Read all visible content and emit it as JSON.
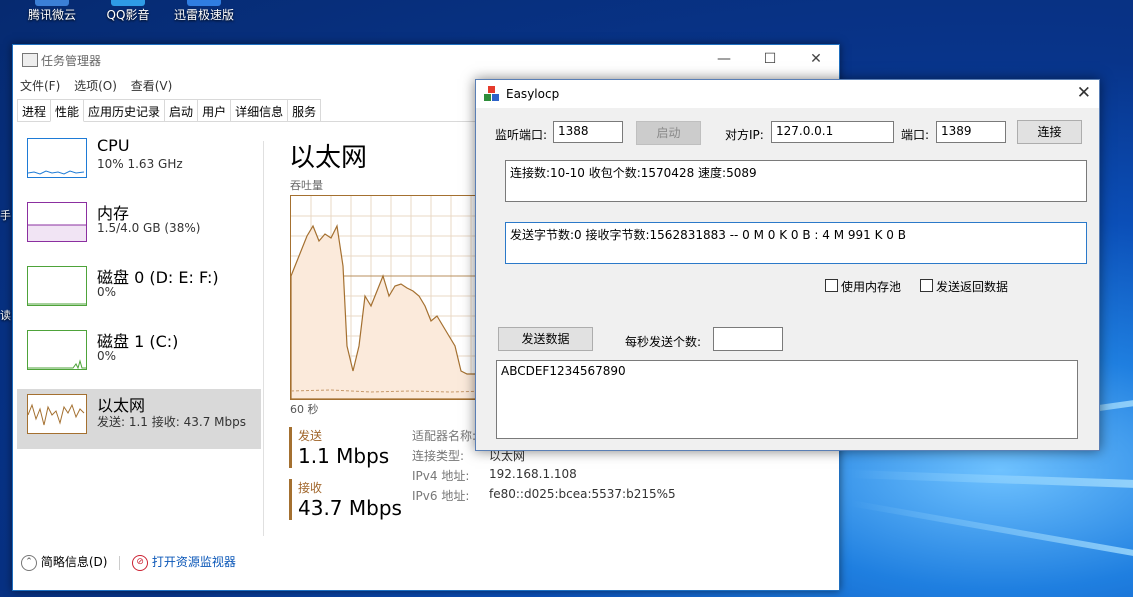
{
  "desktop": {
    "icons": [
      "腾讯微云",
      "QQ影音",
      "迅雷极速版"
    ],
    "side_fragments": [
      "手",
      "读"
    ]
  },
  "taskmgr": {
    "title": "任务管理器",
    "menu": [
      "文件(F)",
      "选项(O)",
      "查看(V)"
    ],
    "tabs": [
      "进程",
      "性能",
      "应用历史记录",
      "启动",
      "用户",
      "详细信息",
      "服务"
    ],
    "resources": [
      {
        "name": "CPU",
        "sub": "10% 1.63 GHz",
        "color": "#1e7bd6"
      },
      {
        "name": "内存",
        "sub": "1.5/4.0 GB (38%)",
        "color": "#8b2fa0"
      },
      {
        "name": "磁盘 0 (D: E: F:)",
        "sub": "0%",
        "color": "#4ea33a"
      },
      {
        "name": "磁盘 1 (C:)",
        "sub": "0%",
        "color": "#4ea33a"
      },
      {
        "name": "以太网",
        "sub": "发送: 1.1 接收: 43.7 Mbps",
        "color": "#a47030"
      }
    ],
    "ethernet": {
      "title": "以太网",
      "throughput_label": "吞吐量",
      "seconds_label": "60 秒",
      "send_label": "发送",
      "send_value": "1.1 Mbps",
      "recv_label": "接收",
      "recv_value": "43.7 Mbps",
      "adapter_label": "适配器名称:",
      "conn_type_label": "连接类型:",
      "conn_type_value": "以太网",
      "ipv4_label": "IPv4 地址:",
      "ipv4_value": "192.168.1.108",
      "ipv6_label": "IPv6 地址:",
      "ipv6_value": "fe80::d025:bcea:5537:b215%5"
    },
    "footer": {
      "brief": "简略信息(D)",
      "monitor": "打开资源监视器"
    }
  },
  "easylocp": {
    "title": "Easylocp",
    "listen_port_label": "监听端口:",
    "listen_port_value": "1388",
    "start_button": "启动",
    "peer_ip_label": "对方IP:",
    "peer_ip_value": "127.0.0.1",
    "port_label": "端口:",
    "port_value": "1389",
    "connect_button": "连接",
    "status_line1": "连接数:10-10  收包个数:1570428 速度:5089",
    "status_line2": "发送字节数:0 接收字节数:1562831883 --  0 M 0 K 0 B : 4 M 991 K 0 B",
    "use_pool_label": "使用内存池",
    "send_back_label": "发送返回数据",
    "send_data_button": "发送数据",
    "per_second_label": "每秒发送个数:",
    "per_second_value": "",
    "payload": "ABCDEF1234567890"
  }
}
